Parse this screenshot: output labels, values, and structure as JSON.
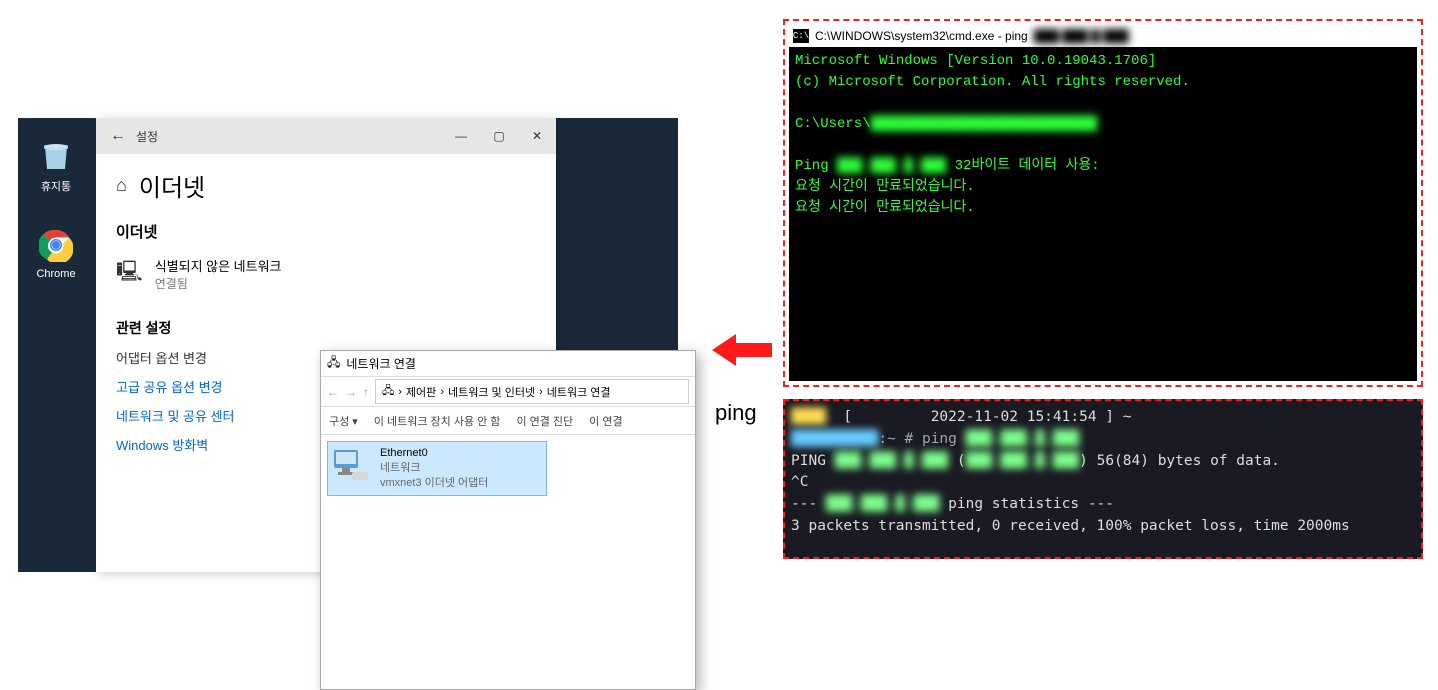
{
  "desktop": {
    "recycle_bin_label": "휴지통",
    "chrome_label": "Chrome"
  },
  "settings": {
    "titlebar_label": "설정",
    "main_heading": "이더넷",
    "sidebar_heading": "이더넷",
    "network_status_line1": "식별되지 않은 네트워크",
    "network_status_line2": "연결됨",
    "related_heading": "관련 설정",
    "link_adapter": "어댑터 옵션 변경",
    "link_advanced": "고급 공유 옵션 변경",
    "link_sharing_center": "네트워크 및 공유 센터",
    "link_firewall": "Windows 방화벽"
  },
  "netconn": {
    "title": "네트워크 연결",
    "breadcrumb1": "제어판",
    "breadcrumb2": "네트워크 및 인터넷",
    "breadcrumb3": "네트워크 연결",
    "toolbar_org": "구성 ▾",
    "toolbar_disable": "이 네트워크 장치 사용 안 함",
    "toolbar_diag": "이 연결 진단",
    "toolbar_this": "이 연결",
    "adapter_name": "Ethernet0",
    "adapter_net": "네트워크",
    "adapter_driver": "vmxnet3 이더넷 어댑터"
  },
  "cmd": {
    "title": "C:\\WINDOWS\\system32\\cmd.exe - ping",
    "title_redacted": "███.███.█.███",
    "line1": "Microsoft Windows [Version 10.0.19043.1706]",
    "line2": "(c) Microsoft Corporation. All rights reserved.",
    "prompt": "C:\\Users\\",
    "prompt_redacted": "███████████████████████████",
    "ping_label": "Ping",
    "ping_ip_redacted": "███.███.█.███",
    "ping_suffix": "32바이트 데이터 사용:",
    "timeout1": "요청 시간이 만료되었습니다.",
    "timeout2": "요청 시간이 만료되었습니다."
  },
  "linux": {
    "prefix_redacted": "████  ",
    "datetime_line": "[         2022-11-02 15:41:54 ] ~",
    "user_redacted": "██████████",
    "prompt_hash": ":~ # ping ",
    "ip_redacted": "███.███.█.███",
    "ping_word": "PING ",
    "paren_open": " (",
    "paren_close": ") 56(84) bytes of data.",
    "ctrlc": "^C",
    "stats_prefix": "--- ",
    "stats_ip_redacted": "███.███.█.███",
    "stats_suffix": " ping statistics ---",
    "summary": "3 packets transmitted, 0 received, 100% packet loss, time 2000ms"
  },
  "labels": {
    "ping": "ping"
  }
}
